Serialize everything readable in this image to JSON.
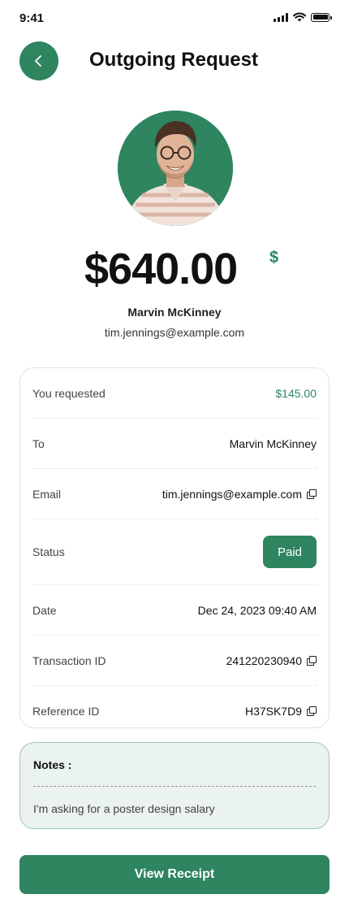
{
  "status_bar": {
    "time": "9:41"
  },
  "header": {
    "title": "Outgoing Request",
    "back_icon": "chevron-left-icon"
  },
  "profile": {
    "name": "Marvin McKinney",
    "email": "tim.jennings@example.com"
  },
  "amount": {
    "value": "$640.00",
    "currency_symbol": "$"
  },
  "details": {
    "requested": {
      "label": "You requested",
      "value": "$145.00"
    },
    "to": {
      "label": "To",
      "value": "Marvin McKinney"
    },
    "email": {
      "label": "Email",
      "value": "tim.jennings@example.com"
    },
    "status": {
      "label": "Status",
      "value": "Paid"
    },
    "date": {
      "label": "Date",
      "value": "Dec 24, 2023 09:40 AM"
    },
    "transaction": {
      "label": "Transaction ID",
      "value": "241220230940"
    },
    "reference": {
      "label": "Reference ID",
      "value": "H37SK7D9"
    }
  },
  "notes": {
    "title": "Notes  :",
    "text": "I'm asking for a poster design salary"
  },
  "actions": {
    "view_receipt": "View Receipt"
  },
  "colors": {
    "accent": "#2e8560",
    "notes_bg": "#ebf3ee"
  }
}
